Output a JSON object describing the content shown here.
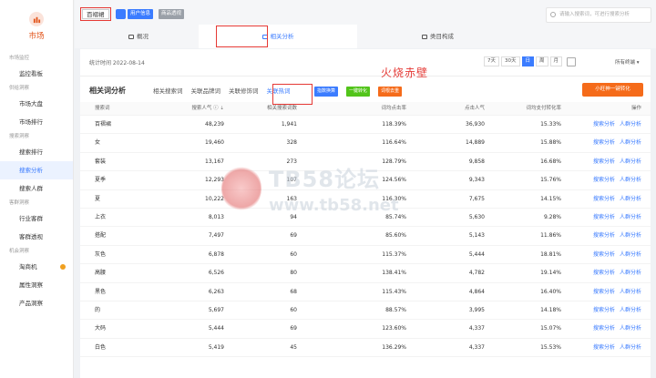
{
  "sidebar": {
    "logo_label": "市场",
    "sections": [
      {
        "title": "市场监控",
        "items": [
          {
            "label": "监控看板"
          }
        ]
      },
      {
        "title": "供给洞察",
        "items": [
          {
            "label": "市场大盘"
          },
          {
            "label": "市场排行"
          }
        ]
      },
      {
        "title": "搜索洞察",
        "items": [
          {
            "label": "搜索排行"
          },
          {
            "label": "搜索分析"
          },
          {
            "label": "搜索人群"
          }
        ]
      },
      {
        "title": "客群洞察",
        "items": [
          {
            "label": "行业客群"
          },
          {
            "label": "客群透视"
          }
        ]
      },
      {
        "title": "机会洞察",
        "items": [
          {
            "label": "淘商机"
          },
          {
            "label": "属性洞察"
          },
          {
            "label": "产品洞察"
          }
        ]
      }
    ]
  },
  "topbar": {
    "shop_name": "百褶裙",
    "user_info": "用户信息",
    "product_insight": "商品透视",
    "search_placeholder": "请输入搜索词，可进行搜索分析"
  },
  "tabs": [
    {
      "label": "概况"
    },
    {
      "label": "相关分析"
    },
    {
      "label": "类目构成"
    }
  ],
  "stats": {
    "time_label": "统计时间 2022-08-14",
    "periods": [
      "7天",
      "30天",
      "日",
      "周",
      "月"
    ],
    "terminal": "所有终端"
  },
  "section": {
    "title": "相关词分析",
    "subtabs": [
      "相关搜索词",
      "关联品牌词",
      "关联修饰词",
      "关联热词"
    ],
    "btn_export": "指数换算",
    "btn_convert": "一键转化",
    "btn_remove": "词根去重",
    "btn_orange": "小旺神一键转化",
    "annotation": "火烧赤壁"
  },
  "table": {
    "columns": [
      "搜索词",
      "搜索人气 ⓘ ⇣",
      "相关搜索词数",
      "词均点击率",
      "点击人气",
      "词均支付转化率",
      "操作"
    ],
    "action_labels": [
      "搜索分析",
      "人群分析"
    ],
    "rows": [
      [
        "百褶裙",
        "48,239",
        "1,941",
        "118.39%",
        "36,930",
        "15.33%"
      ],
      [
        "女",
        "19,460",
        "328",
        "116.64%",
        "14,889",
        "15.88%"
      ],
      [
        "套装",
        "13,167",
        "273",
        "128.79%",
        "9,858",
        "16.68%"
      ],
      [
        "夏季",
        "12,293",
        "107",
        "124.56%",
        "9,343",
        "15.76%"
      ],
      [
        "夏",
        "10,222",
        "163",
        "116.30%",
        "7,675",
        "14.15%"
      ],
      [
        "上衣",
        "8,013",
        "94",
        "85.74%",
        "5,630",
        "9.28%"
      ],
      [
        "搭配",
        "7,497",
        "69",
        "85.60%",
        "5,143",
        "11.86%"
      ],
      [
        "灰色",
        "6,878",
        "60",
        "115.37%",
        "5,444",
        "18.81%"
      ],
      [
        "高腰",
        "6,526",
        "80",
        "138.41%",
        "4,782",
        "19.14%"
      ],
      [
        "黑色",
        "6,263",
        "68",
        "115.43%",
        "4,864",
        "16.40%"
      ],
      [
        "的",
        "5,697",
        "60",
        "88.57%",
        "3,995",
        "14.18%"
      ],
      [
        "大码",
        "5,444",
        "69",
        "123.60%",
        "4,337",
        "15.07%"
      ],
      [
        "白色",
        "5,419",
        "45",
        "136.29%",
        "4,337",
        "15.53%"
      ]
    ]
  },
  "watermark": {
    "title": "TB58论坛",
    "url": "www.tb58.net"
  },
  "colors": {
    "accent": "#3b7cff",
    "brand": "#e2541a",
    "annotation": "#e53935",
    "orange": "#f56b1a"
  }
}
